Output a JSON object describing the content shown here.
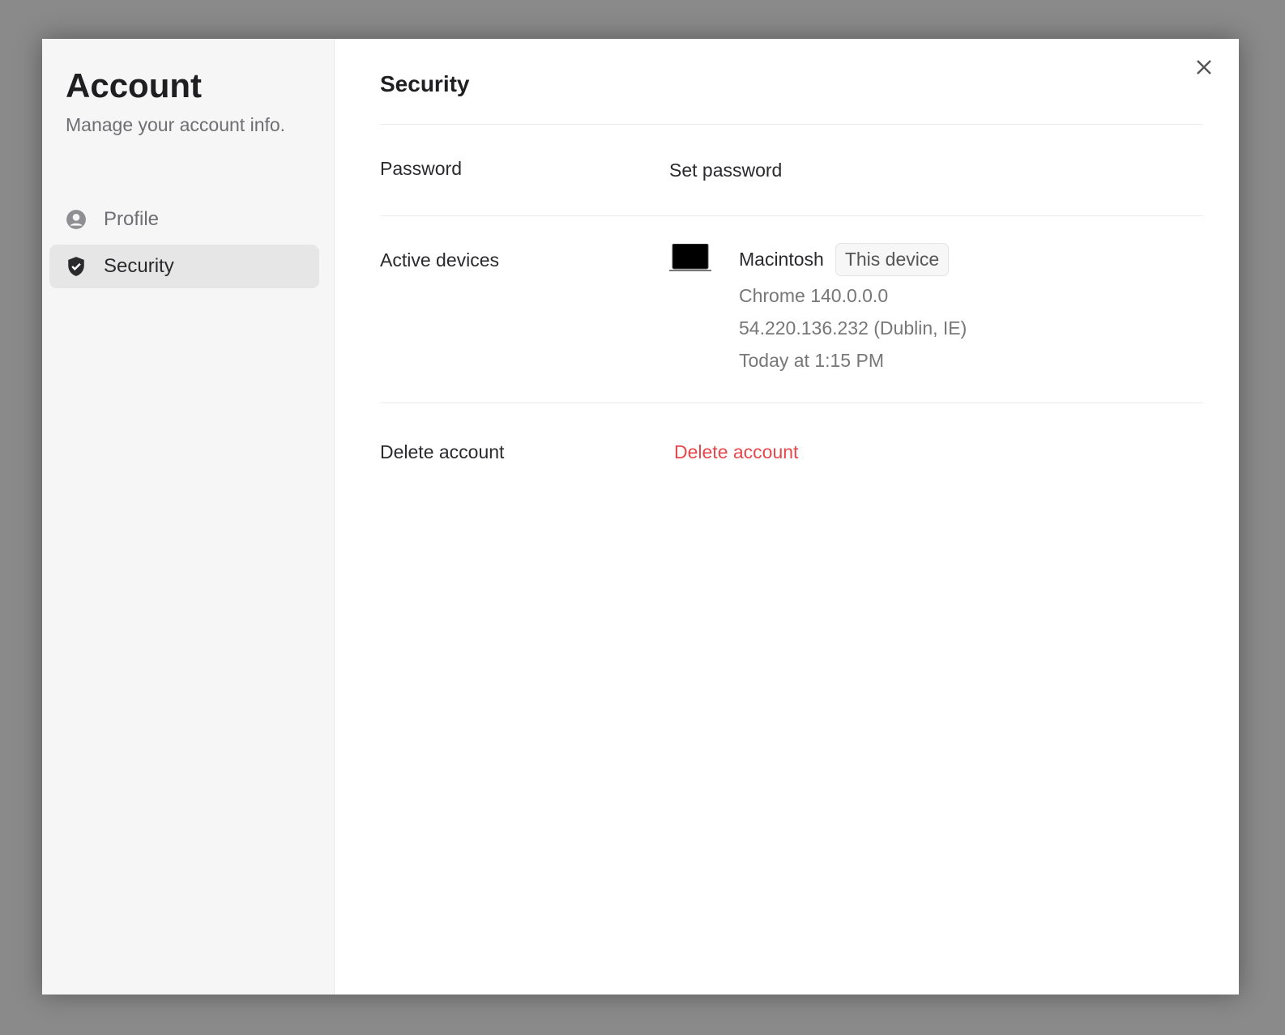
{
  "sidebar": {
    "title": "Account",
    "subtitle": "Manage your account info.",
    "items": [
      {
        "label": "Profile",
        "icon": "user-circle-icon"
      },
      {
        "label": "Security",
        "icon": "shield-check-icon",
        "active": true
      }
    ]
  },
  "main": {
    "title": "Security",
    "password": {
      "label": "Password",
      "action": "Set password"
    },
    "devices": {
      "label": "Active devices",
      "device": {
        "name": "Macintosh",
        "badge": "This device",
        "browser": "Chrome 140.0.0.0",
        "ip": "54.220.136.232 (Dublin, IE)",
        "last_active": "Today at 1:15 PM"
      }
    },
    "delete": {
      "label": "Delete account",
      "action": "Delete account"
    }
  },
  "colors": {
    "danger": "#e5484d",
    "active_bg": "#e6e6e6"
  }
}
